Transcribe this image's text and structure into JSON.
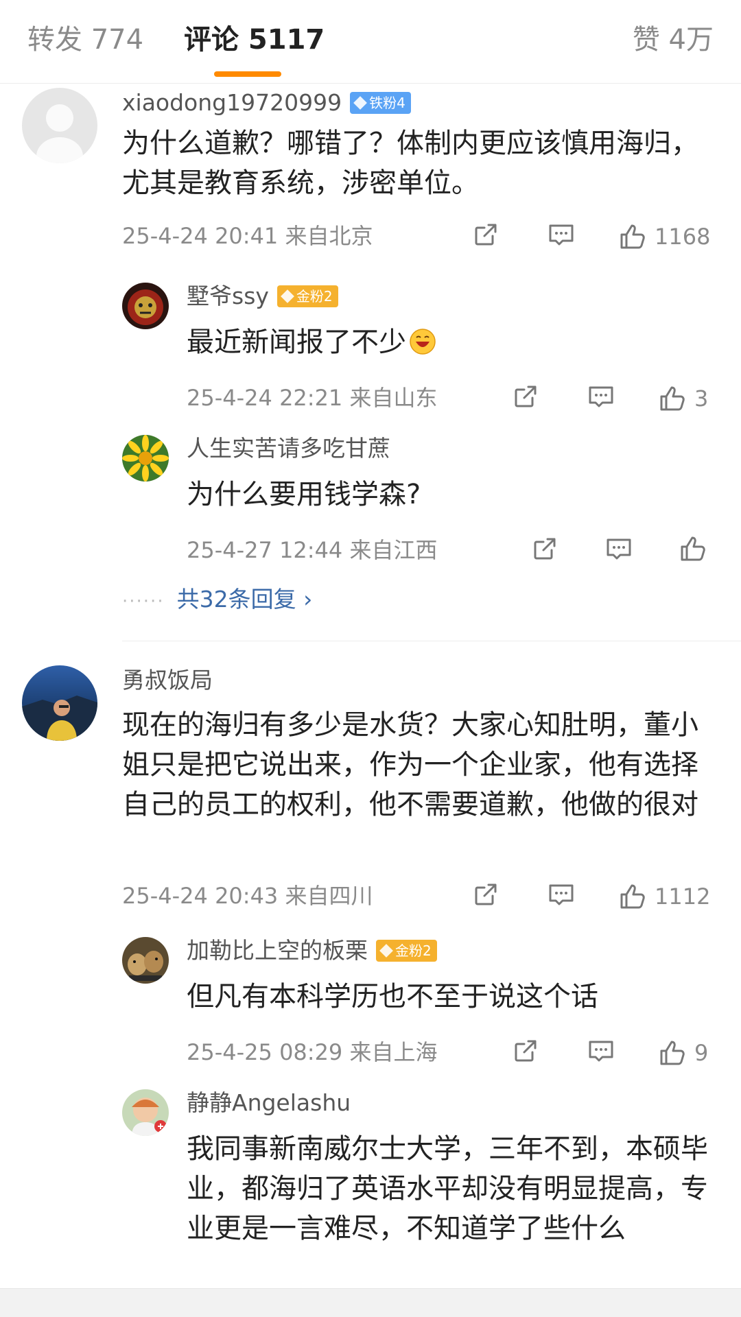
{
  "tabs": {
    "forward": "转发 774",
    "comments": "评论 5117",
    "likes": "赞 4万"
  },
  "comments": [
    {
      "author": "xiaodong19720999",
      "badge": "铁粉4",
      "text": "为什么道歉？哪错了？体制内更应该慎用海归，尤其是教育系统，涉密单位。",
      "meta": "25-4-24 20:41  来自北京",
      "likes": "1168",
      "replies": [
        {
          "author": "墅爷ssy",
          "badge": "金粉2",
          "text": "最近新闻报了不少",
          "meta": "25-4-24 22:21  来自山东",
          "likes": "3"
        },
        {
          "author": "人生实苦请多吃甘蔗",
          "text": "为什么要用钱学森?",
          "meta": "25-4-27 12:44  来自江西",
          "likes": ""
        }
      ],
      "more_replies": "共32条回复 ›"
    },
    {
      "author": "勇叔饭局",
      "text": "现在的海归有多少是水货？大家心知肚明，董小姐只是把它说出来，作为一个企业家，他有选择自己的员工的权利，他不需要道歉，他做的很对",
      "meta": "25-4-24 20:43  来自四川",
      "likes": "1112",
      "replies": [
        {
          "author": "加勒比上空的板栗",
          "badge": "金粉2",
          "text": "但凡有本科学历也不至于说这个话",
          "meta": "25-4-25 08:29  来自上海",
          "likes": "9"
        },
        {
          "author": "静静Angelashu",
          "text": "我同事新南威尔士大学，三年不到，本硕毕业，都海归了英语水平却没有明显提高，专业更是一言难尽，不知道学了些什么"
        }
      ]
    }
  ],
  "icons": [
    "share-icon",
    "comment-icon",
    "like-icon",
    "grin-emoji-icon",
    "chevron-right-icon"
  ],
  "colors": {
    "accent": "#ff8a00",
    "link": "#3b6aa8",
    "iron_badge": "#5aa3f5",
    "gold_badge": "#f5b12e"
  }
}
